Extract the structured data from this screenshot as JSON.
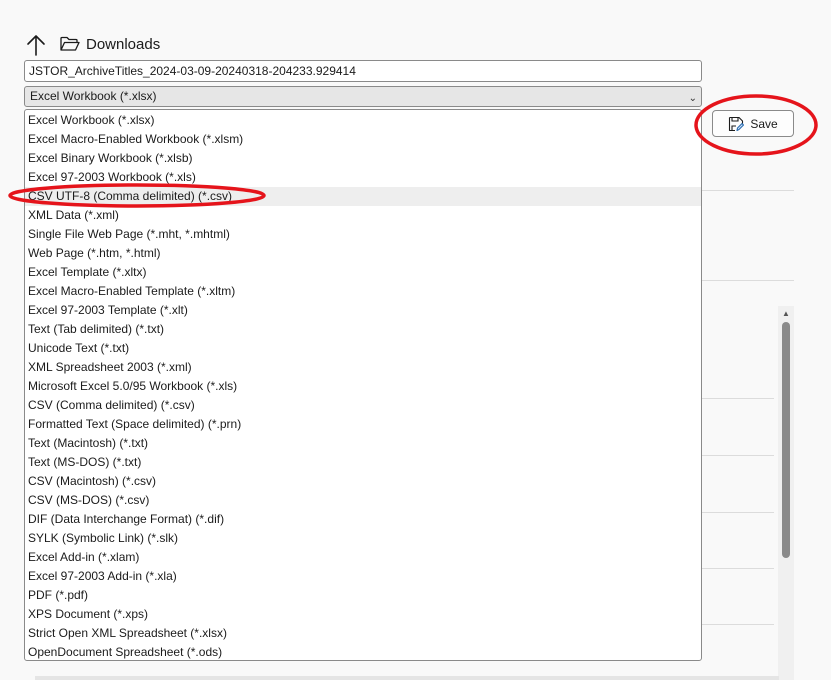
{
  "location": {
    "folder_name": "Downloads"
  },
  "filename": {
    "value": "JSTOR_ArchiveTitles_2024-03-09-20240318-204233.929414"
  },
  "filetype": {
    "selected": "Excel Workbook (*.xlsx)",
    "options": [
      "Excel Workbook (*.xlsx)",
      "Excel Macro-Enabled Workbook (*.xlsm)",
      "Excel Binary Workbook (*.xlsb)",
      "Excel 97-2003 Workbook (*.xls)",
      "CSV UTF-8 (Comma delimited) (*.csv)",
      "XML Data (*.xml)",
      "Single File Web Page (*.mht, *.mhtml)",
      "Web Page (*.htm, *.html)",
      "Excel Template (*.xltx)",
      "Excel Macro-Enabled Template (*.xltm)",
      "Excel 97-2003 Template (*.xlt)",
      "Text (Tab delimited) (*.txt)",
      "Unicode Text (*.txt)",
      "XML Spreadsheet 2003 (*.xml)",
      "Microsoft Excel 5.0/95 Workbook (*.xls)",
      "CSV (Comma delimited) (*.csv)",
      "Formatted Text (Space delimited) (*.prn)",
      "Text (Macintosh) (*.txt)",
      "Text (MS-DOS) (*.txt)",
      "CSV (Macintosh) (*.csv)",
      "CSV (MS-DOS) (*.csv)",
      "DIF (Data Interchange Format) (*.dif)",
      "SYLK (Symbolic Link) (*.slk)",
      "Excel Add-in (*.xlam)",
      "Excel 97-2003 Add-in (*.xla)",
      "PDF (*.pdf)",
      "XPS Document (*.xps)",
      "Strict Open XML Spreadsheet (*.xlsx)",
      "OpenDocument Spreadsheet (*.ods)"
    ],
    "hovered_index": 4
  },
  "toolbar": {
    "save_label": "Save"
  },
  "colors": {
    "annotation_red": "#e5141b",
    "hover_background": "#eeeeee",
    "select_background": "#e6e6e6"
  },
  "icons": {
    "up": "up-arrow-icon",
    "folder": "open-folder-icon",
    "chevron": "chevron-down-icon",
    "save": "save-disk-pencil-icon"
  }
}
